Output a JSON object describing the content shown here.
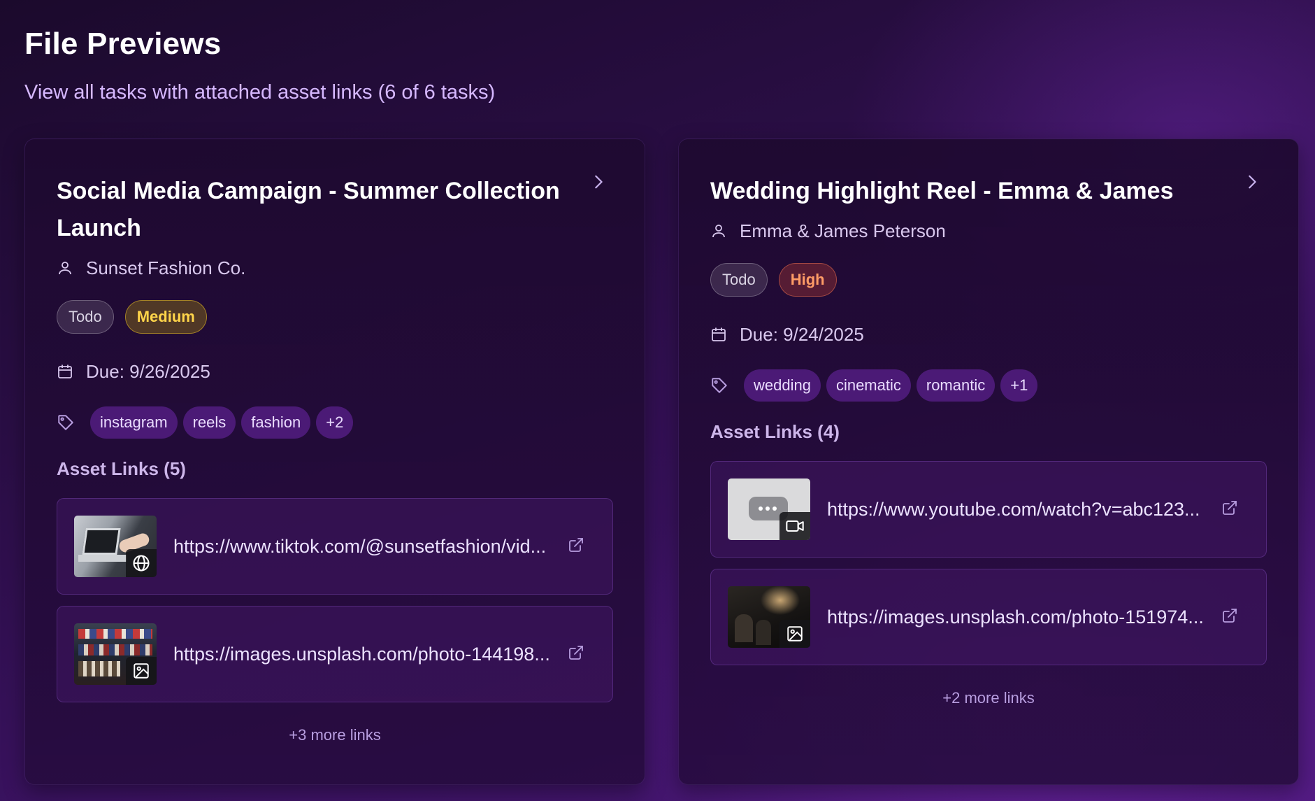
{
  "header": {
    "title": "File Previews",
    "subtitle": "View all tasks with attached asset links (6 of 6 tasks)"
  },
  "colors": {
    "accent": "#d6b8ff",
    "medium_priority": "#ffd54a",
    "high_priority": "#ff9c66",
    "tag_bg": "#6e28aa"
  },
  "cards": [
    {
      "title": "Social Media Campaign - Summer Collection Launch",
      "client": "Sunset Fashion Co.",
      "status": "Todo",
      "priority": "Medium",
      "due": "Due: 9/26/2025",
      "tags": [
        "instagram",
        "reels",
        "fashion",
        "+2"
      ],
      "asset_heading": "Asset Links (5)",
      "assets": [
        {
          "url": "https://www.tiktok.com/@sunsetfashion/vid...",
          "type_icon": "globe-icon"
        },
        {
          "url": "https://images.unsplash.com/photo-144198...",
          "type_icon": "image-icon"
        }
      ],
      "more_links": "+3 more links"
    },
    {
      "title": "Wedding Highlight Reel - Emma & James",
      "client": "Emma & James Peterson",
      "status": "Todo",
      "priority": "High",
      "due": "Due: 9/24/2025",
      "tags": [
        "wedding",
        "cinematic",
        "romantic",
        "+1"
      ],
      "asset_heading": "Asset Links (4)",
      "assets": [
        {
          "url": "https://www.youtube.com/watch?v=abc123...",
          "type_icon": "video-icon"
        },
        {
          "url": "https://images.unsplash.com/photo-151974...",
          "type_icon": "image-icon"
        }
      ],
      "more_links": "+2 more links"
    }
  ]
}
